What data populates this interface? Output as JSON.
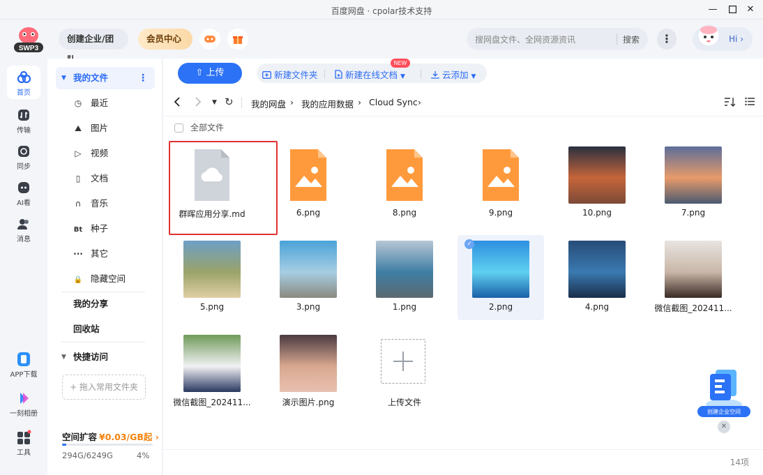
{
  "window": {
    "title": "百度网盘 · cpolar技术支持",
    "controls": [
      "minimize",
      "maximize",
      "close"
    ]
  },
  "header": {
    "logo_text": "SWP3",
    "team_button": "创建企业/团队",
    "vip_button": "会员中心",
    "search_placeholder": "搜网盘文件、全网资源资讯",
    "search_button": "搜索",
    "hi_label": "Hi",
    "hi_arrow": "›"
  },
  "rail": [
    {
      "label": "首页",
      "icon": "home-icon",
      "active": true
    },
    {
      "label": "传输",
      "icon": "transfer-icon"
    },
    {
      "label": "同步",
      "icon": "sync-icon"
    },
    {
      "label": "AI看",
      "icon": "ai-icon"
    },
    {
      "label": "消息",
      "icon": "message-icon"
    },
    {
      "label": "APP下载",
      "icon": "phone-icon"
    },
    {
      "label": "一刻相册",
      "icon": "album-icon"
    },
    {
      "label": "工具",
      "icon": "tools-icon"
    }
  ],
  "sidebar": {
    "my_files": "我的文件",
    "items": [
      {
        "label": "最近",
        "icon": "clock-icon",
        "glyph": "◷"
      },
      {
        "label": "图片",
        "icon": "image-icon",
        "glyph": "⛰"
      },
      {
        "label": "视频",
        "icon": "video-icon",
        "glyph": "▷"
      },
      {
        "label": "文档",
        "icon": "document-icon",
        "glyph": "▯"
      },
      {
        "label": "音乐",
        "icon": "headphones-icon",
        "glyph": "∩"
      },
      {
        "label": "种子",
        "icon": "torrent-icon",
        "glyph": "Bt"
      },
      {
        "label": "其它",
        "icon": "more-icon",
        "glyph": "···"
      },
      {
        "label": "隐藏空间",
        "icon": "lock-icon",
        "glyph": "🔒"
      }
    ],
    "my_share": "我的分享",
    "recycle": "回收站",
    "quick_access": "快捷访问",
    "drop_hint": "+ 拖入常用文件夹",
    "space_label": "空间扩容",
    "space_price": "¥0.03/GB起",
    "space_arrow": "›",
    "space_used": "294G/6249G",
    "space_percent": "4%",
    "space_fraction": 0.047
  },
  "toolbar": {
    "upload": "上传",
    "new_folder": "新建文件夹",
    "new_doc": "新建在线文档",
    "new_badge": "NEW",
    "cloud_add": "云添加"
  },
  "breadcrumb": [
    "我的网盘",
    "我的应用数据",
    "Cloud Sync"
  ],
  "all_files": "全部文件",
  "files": [
    {
      "name": "群晖应用分享.md",
      "type": "cloud-doc"
    },
    {
      "name": "6.png",
      "type": "image-placeholder"
    },
    {
      "name": "8.png",
      "type": "image-placeholder"
    },
    {
      "name": "9.png",
      "type": "image-placeholder"
    },
    {
      "name": "10.png",
      "type": "photo",
      "colors": [
        "#2a3040",
        "#c6653a",
        "#7c4a38"
      ]
    },
    {
      "name": "7.png",
      "type": "photo",
      "colors": [
        "#5c6e9a",
        "#e89a6a",
        "#4a5a70"
      ]
    },
    {
      "name": "5.png",
      "type": "photo",
      "colors": [
        "#6d9fc6",
        "#9aa36a",
        "#e0cfa4"
      ]
    },
    {
      "name": "3.png",
      "type": "photo",
      "colors": [
        "#4aa3d8",
        "#a7cde3",
        "#8a8a80"
      ]
    },
    {
      "name": "1.png",
      "type": "photo",
      "colors": [
        "#b6c7d4",
        "#3f7ea4",
        "#5b6a70"
      ]
    },
    {
      "name": "2.png",
      "type": "photo",
      "colors": [
        "#2e8fe0",
        "#5fd0f0",
        "#1a5fa8"
      ],
      "selected": true
    },
    {
      "name": "4.png",
      "type": "photo",
      "colors": [
        "#284c78",
        "#3a7ab0",
        "#1a2e4a"
      ]
    },
    {
      "name": "微信截图_202411...",
      "type": "photo",
      "colors": [
        "#e8e4e0",
        "#c9b6a8",
        "#3a2a24"
      ]
    },
    {
      "name": "微信截图_202411...",
      "type": "photo",
      "colors": [
        "#6f9a5a",
        "#f2f2f4",
        "#2a3860"
      ]
    },
    {
      "name": "演示图片.png",
      "type": "photo",
      "colors": [
        "#4a3a40",
        "#d8a890",
        "#e8c0b0"
      ]
    },
    {
      "name": "上传文件",
      "type": "upload"
    }
  ],
  "item_count": "14项",
  "float_card": "创建企业空间"
}
